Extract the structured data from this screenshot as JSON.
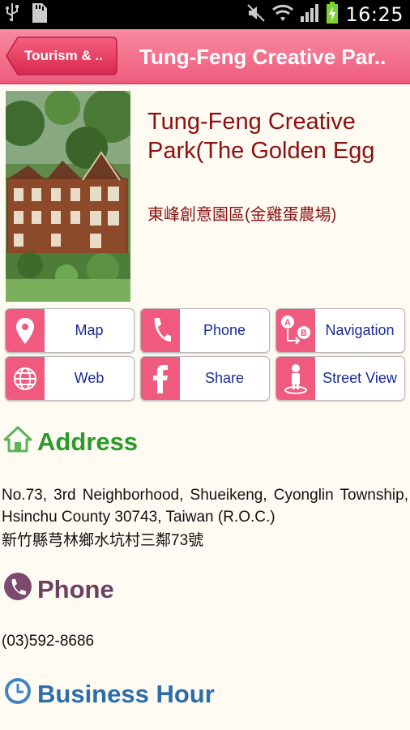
{
  "status_bar": {
    "time": "16:25"
  },
  "action_bar": {
    "back_label": "Tourism & ..",
    "title": "Tung-Feng Creative Par.."
  },
  "place": {
    "name_en": "Tung-Feng Creative Park(The Golden Egg",
    "name_zh": "東峰創意園區(金雞蛋農場)"
  },
  "actions": [
    {
      "label": "Map",
      "icon": "map-pin-icon"
    },
    {
      "label": "Phone",
      "icon": "phone-icon"
    },
    {
      "label": "Navigation",
      "icon": "navigation-icon"
    },
    {
      "label": "Web",
      "icon": "globe-icon"
    },
    {
      "label": "Share",
      "icon": "facebook-icon"
    },
    {
      "label": "Street View",
      "icon": "street-view-icon"
    }
  ],
  "address": {
    "heading": "Address",
    "text_en": "No.73, 3rd Neighborhood, Shueikeng, Cyonglin Township, Hsinchu County 30743, Taiwan (R.O.C.)",
    "text_zh": "新竹縣芎林鄉水坑村三鄰73號"
  },
  "phone": {
    "heading": "Phone",
    "number": "(03)592-8686"
  },
  "business_hour": {
    "heading": "Business Hour"
  },
  "colors": {
    "accent": "#ef5a7e",
    "address_heading": "#2a9a2a",
    "phone_heading": "#6b4060",
    "hours_heading": "#2b6ea8",
    "title_text": "#8b1010",
    "action_label": "#1a2a9a"
  }
}
